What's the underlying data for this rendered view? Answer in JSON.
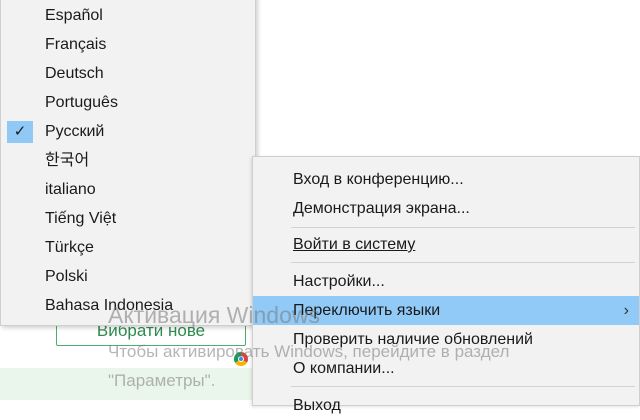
{
  "background": {
    "button_label": "Вибрати нове"
  },
  "language_menu": {
    "items": [
      {
        "label": "Español",
        "checked": false
      },
      {
        "label": "Français",
        "checked": false
      },
      {
        "label": "Deutsch",
        "checked": false
      },
      {
        "label": "Português",
        "checked": false
      },
      {
        "label": "Русский",
        "checked": true
      },
      {
        "label": "한국어",
        "checked": false
      },
      {
        "label": "italiano",
        "checked": false
      },
      {
        "label": "Tiếng Việt",
        "checked": false
      },
      {
        "label": "Türkçe",
        "checked": false
      },
      {
        "label": "Polski",
        "checked": false
      },
      {
        "label": "Bahasa Indonesia",
        "checked": false
      }
    ],
    "check_glyph": "✓"
  },
  "context_menu": {
    "join_meeting": "Вход в конференцию...",
    "screen_share": "Демонстрация экрана...",
    "sign_in": "Войти в систему",
    "settings": "Настройки...",
    "switch_language": "Переключить языки",
    "check_updates": "Проверить наличие обновлений",
    "about": "О компании...",
    "exit_partial": "Выход",
    "submenu_arrow": "›"
  },
  "watermark": {
    "title": "Активация Windows",
    "line1": "Чтобы активировать Windows, перейдите в раздел",
    "line2": "\"Параметры\"."
  },
  "colors": {
    "menu_bg": "#f2f2f2",
    "highlight": "#91c9f7",
    "check_bg": "#90c8f6",
    "accent_green": "#4caf6d"
  }
}
